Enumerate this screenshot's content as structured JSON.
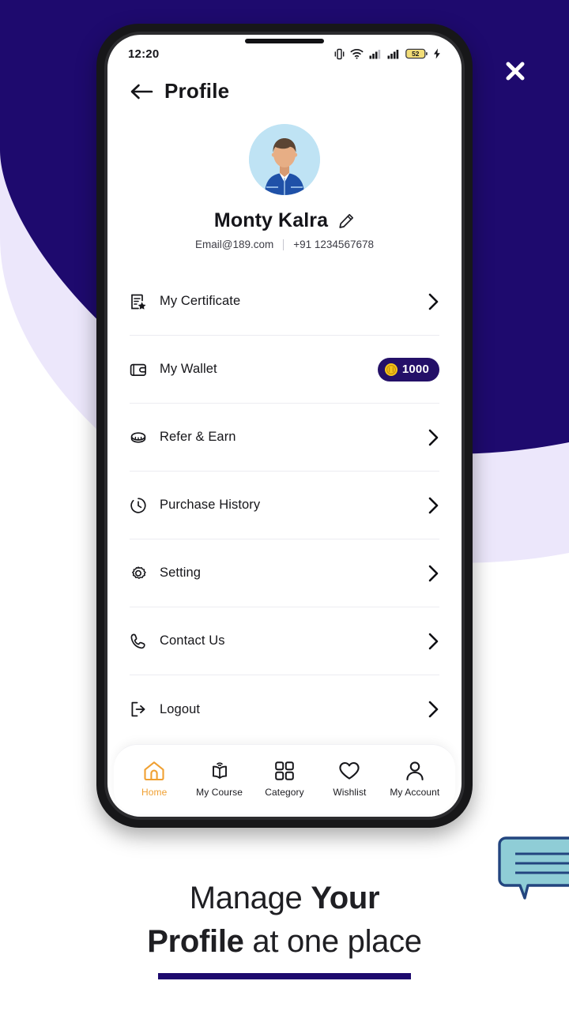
{
  "theme": {
    "navy": "#1e0a6e",
    "lavender": "#ece7fb",
    "accent_orange": "#f0a032",
    "badge_navy": "#241068",
    "coin_gold": "#f5c518",
    "bubble_teal": "#8fcdd6",
    "bubble_outline": "#23457f"
  },
  "overlay": {
    "close_label": "close-icon"
  },
  "phone": {
    "statusbar": {
      "time": "12:20",
      "icons": [
        "vibrate-icon",
        "wifi-icon",
        "signal-icon",
        "signal-icon",
        "battery-icon",
        "charging-bolt-icon"
      ],
      "battery_level": "52"
    },
    "appbar": {
      "back_label": "back-arrow-icon",
      "title": "Profile"
    },
    "profile": {
      "avatar_alt": "user-avatar",
      "name": "Monty Kalra",
      "edit_label": "edit-pencil-icon",
      "email": "Email@189.com",
      "phone": "+91 1234567678"
    },
    "menu": [
      {
        "label": "My Certificate",
        "icon": "certificate-icon",
        "trailing": "chevron"
      },
      {
        "label": "My Wallet",
        "icon": "wallet-icon",
        "trailing": "badge",
        "badge_value": "1000"
      },
      {
        "label": "Refer & Earn",
        "icon": "coin-icon",
        "trailing": "chevron"
      },
      {
        "label": "Purchase History",
        "icon": "clock-history-icon",
        "trailing": "chevron"
      },
      {
        "label": "Setting",
        "icon": "gear-icon",
        "trailing": "chevron"
      },
      {
        "label": "Contact Us",
        "icon": "phone-icon",
        "trailing": "chevron"
      },
      {
        "label": "Logout",
        "icon": "logout-icon",
        "trailing": "chevron"
      }
    ],
    "bottom_nav": [
      {
        "label": "Home",
        "icon": "home-icon",
        "active": true
      },
      {
        "label": "My Course",
        "icon": "book-wifi-icon",
        "active": false
      },
      {
        "label": "Category",
        "icon": "grid-icon",
        "active": false
      },
      {
        "label": "Wishlist",
        "icon": "heart-icon",
        "active": false
      },
      {
        "label": "My Account",
        "icon": "person-icon",
        "active": false
      }
    ]
  },
  "caption": {
    "line1_plain": "Manage ",
    "line1_bold": "Your",
    "line2_bold": "Profile",
    "line2_plain": " at one place"
  }
}
